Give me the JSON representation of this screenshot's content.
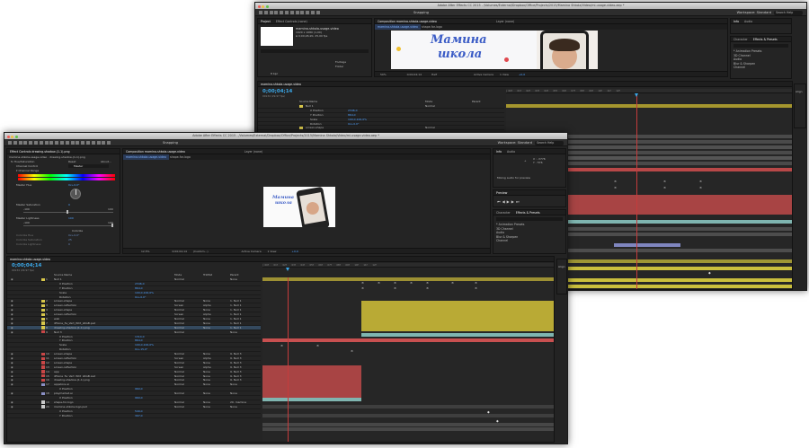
{
  "back": {
    "title": "Adobe After Effects CC 2015 - /Volumes/External/Dropbox/Office/Projects/2015/Mamina Shkola/Video/mi-usage-video.aep *",
    "snapping": "Snapping",
    "workspace_label": "Workspace:",
    "workspace_value": "Standard",
    "search_placeholder": "Search Help",
    "project_tabs": [
      "Project",
      "Effect Controls (none)"
    ],
    "project_info": [
      "mamina-shkola-usage-video",
      "1920 x 1080 (1,00)",
      "Δ 0;00;26;20, 25,00 fps"
    ],
    "project_items": [
      "Footage",
      "Folder"
    ],
    "project_bits": "8 bpc",
    "comp_tab": "Composition mamina-shkola-usage-video",
    "layer_tab": "Layer (none)",
    "comp_subtab": "mamina-shkola-usage-video",
    "comp_subtab2": "shape-for-logo",
    "logo_line1": "Мамина",
    "logo_line2": "школа",
    "viewer_controls": [
      "50%",
      "0;00;04;14",
      "Half",
      "Active Camera",
      "1 View",
      "+0,0"
    ],
    "info_tabs": [
      "Info",
      "Audio"
    ],
    "effects_tabs": [
      "Character",
      "Effects & Presets"
    ],
    "effects_list": [
      "* Animation Presets",
      "3D Channel",
      "Audio",
      "Blur & Sharpen",
      "Channel"
    ],
    "align_label": "Align",
    "timeline_tab": "mamina-shkola-usage-video",
    "timecode": "0;00;04;14",
    "frame_info": "00134 (29.97 fps)",
    "source_header": "Source Name",
    "mode_header": "Mode",
    "parent_header": "Parent",
    "layers": [
      {
        "name": "Null 1",
        "mode": "Normal",
        "color": "#d6c54a"
      },
      {
        "name": "X Position",
        "value": "2346,0",
        "color": ""
      },
      {
        "name": "Y Position",
        "value": "864,0",
        "color": ""
      },
      {
        "name": "Scale",
        "value": "100,0,100,0%",
        "color": ""
      },
      {
        "name": "Rotation",
        "value": "0x+0,0°",
        "color": ""
      },
      {
        "name": "screen-shape",
        "mode": "Normal",
        "color": "#d6c54a"
      }
    ]
  },
  "front": {
    "title": "Adobe After Effects CC 2015 - /Volumes/External/Dropbox/Office/Projects/2015/Mamina Shkola/Video/mi-usage-video.aep *",
    "snapping": "Snapping",
    "workspace_label": "Workspace:",
    "workspace_value": "Standard",
    "search_placeholder": "Search Help",
    "fx_tab": "Effect Controls drawing-shadow-(1-1).png",
    "fx_header": "mamina-shkola-usage-video · drawing-shadow-(1-1).png",
    "fx_rows": [
      {
        "k": "fx Hue/Saturation",
        "v": "Reset",
        "v2": "About..."
      },
      {
        "k": "Channel Control",
        "v": "Master",
        "v2": ""
      },
      {
        "k": "▾ Channel Range",
        "v": "",
        "v2": ""
      },
      {
        "k": "Master Hue",
        "v": "0x+0,0°",
        "v2": ""
      },
      {
        "k": "Master Saturation",
        "v": "0",
        "v2": ""
      },
      {
        "k": "-100",
        "v": "",
        "v2": "100"
      },
      {
        "k": "Master Lightness",
        "v": "100",
        "v2": ""
      },
      {
        "k": "-100",
        "v": "",
        "v2": "100"
      },
      {
        "k": "",
        "v": "Colorize",
        "v2": ""
      },
      {
        "k": "Colorize Hue",
        "v": "0x+0,0°",
        "v2": ""
      },
      {
        "k": "Colorize Saturation",
        "v": "25",
        "v2": ""
      },
      {
        "k": "Colorize Lightness",
        "v": "0",
        "v2": ""
      }
    ],
    "comp_tab": "Composition mamina-shkola-usage-video",
    "layer_tab": "Layer (none)",
    "comp_subtab": "mamina-shkola-usage-video",
    "comp_subtab2": "shape-for-logo",
    "mini_logo1": "Мамина",
    "mini_logo2": "школа",
    "viewer_controls": [
      "12,5%",
      "0;00;04;14",
      "(Custom...)",
      "Active Camera",
      "1 View",
      "+0,0"
    ],
    "info_tabs": [
      "Info",
      "Audio"
    ],
    "info_values": [
      "X : -3776",
      "Y : 576",
      "+"
    ],
    "info_msg": "Mixing audio for preview",
    "preview_label": "Preview",
    "effects_tabs": [
      "Character",
      "Effects & Presets"
    ],
    "effects_list": [
      "* Animation Presets",
      "3D Channel",
      "Audio",
      "Blur & Sharpen",
      "Channel"
    ],
    "align_label": "Align",
    "timeline_tab": "mamina-shkola-usage-video",
    "timecode": "0;00;04;14",
    "frame_info": "00134 (29.97 fps)",
    "source_header": "Source Name",
    "mode_header": "Mode",
    "trkmat_header": "TrkMat",
    "parent_header": "Parent",
    "layers": [
      {
        "num": "1",
        "name": "Null 1",
        "color": "#d6c54a",
        "mode": "Normal",
        "trk": "",
        "parent": "None"
      },
      {
        "num": "",
        "name": "X Position",
        "color": "",
        "value": "2346,0"
      },
      {
        "num": "",
        "name": "Y Position",
        "color": "",
        "value": "864,0"
      },
      {
        "num": "",
        "name": "Scale",
        "color": "",
        "value": "100,0,100,0%"
      },
      {
        "num": "",
        "name": "Rotation",
        "color": "",
        "value": "0x+0,0°"
      },
      {
        "num": "2",
        "name": "screen-shape",
        "color": "#d6c54a",
        "mode": "Normal",
        "trk": "None",
        "parent": "1. Null 1"
      },
      {
        "num": "3",
        "name": "screen-reflection",
        "color": "#d6c54a",
        "mode": "Screen",
        "trk": "Alpha",
        "parent": "1. Null 1"
      },
      {
        "num": "4",
        "name": "screen-shape",
        "color": "#d6c54a",
        "mode": "Normal",
        "trk": "None",
        "parent": "1. Null 1"
      },
      {
        "num": "5",
        "name": "screen-reflection",
        "color": "#d6c54a",
        "mode": "Screen",
        "trk": "Alpha",
        "parent": "1. Null 1"
      },
      {
        "num": "6",
        "name": "web",
        "color": "#d6c54a",
        "mode": "Normal",
        "trk": "None",
        "parent": "1. Null 1"
      },
      {
        "num": "7",
        "name": "iPhone_5s_Vert_Wht_LRGB.psd",
        "color": "#d6c54a",
        "mode": "Normal",
        "trk": "None",
        "parent": "1. Null 1"
      },
      {
        "num": "8",
        "name": "drawing-shadow-(1-1).png",
        "color": "#d6c54a",
        "mode": "Normal",
        "trk": "None",
        "parent": "1. Null 1",
        "sel": true
      },
      {
        "num": "9",
        "name": "Null 3",
        "color": "#c84646",
        "mode": "Normal",
        "trk": "",
        "parent": "None"
      },
      {
        "num": "",
        "name": "X Position",
        "color": "",
        "value": "1314,0"
      },
      {
        "num": "",
        "name": "Y Position",
        "color": "",
        "value": "864,0"
      },
      {
        "num": "",
        "name": "Scale",
        "color": "",
        "value": "100,0,100,0%"
      },
      {
        "num": "",
        "name": "Rotation",
        "color": "",
        "value": "0x+15,0°"
      },
      {
        "num": "10",
        "name": "screen-shape",
        "color": "#c84646",
        "mode": "Normal",
        "trk": "None",
        "parent": "9. Null 3"
      },
      {
        "num": "11",
        "name": "screen-reflection",
        "color": "#c84646",
        "mode": "Screen",
        "trk": "Alpha",
        "parent": "9. Null 3"
      },
      {
        "num": "12",
        "name": "screen-shape",
        "color": "#c84646",
        "mode": "Normal",
        "trk": "None",
        "parent": "9. Null 3"
      },
      {
        "num": "13",
        "name": "screen-reflection",
        "color": "#c84646",
        "mode": "Screen",
        "trk": "Alpha",
        "parent": "9. Null 3"
      },
      {
        "num": "14",
        "name": "app",
        "color": "#c84646",
        "mode": "Normal",
        "trk": "None",
        "parent": "9. Null 3"
      },
      {
        "num": "15",
        "name": "iPhone_5s_Vert_Wht_LRGB.psd",
        "color": "#c84646",
        "mode": "Normal",
        "trk": "None",
        "parent": "9. Null 3"
      },
      {
        "num": "16",
        "name": "drawing-shadow-(1-1).png",
        "color": "#c84646",
        "mode": "Normal",
        "trk": "None",
        "parent": "9. Null 3"
      },
      {
        "num": "17",
        "name": "appstore.ai",
        "color": "#8a8fc4",
        "mode": "Normal",
        "trk": "None",
        "parent": "None"
      },
      {
        "num": "",
        "name": "X Position",
        "color": "",
        "value": "960,0"
      },
      {
        "num": "18",
        "name": "playmarket.ai",
        "color": "#8a8fc4",
        "mode": "Normal",
        "trk": "None",
        "parent": "None"
      },
      {
        "num": "",
        "name": "X Position",
        "color": "",
        "value": "960,0"
      },
      {
        "num": "19",
        "name": "shape-for-logo",
        "color": "#c9c9c9",
        "mode": "Normal",
        "trk": "None",
        "parent": "20. mamina"
      },
      {
        "num": "20",
        "name": "mamina-shkola-logo.psd",
        "color": "#c9c9c9",
        "mode": "Normal",
        "trk": "None",
        "parent": "None"
      },
      {
        "num": "",
        "name": "X Position",
        "color": "",
        "value": "549,0"
      },
      {
        "num": "",
        "name": "Y Position",
        "color": "",
        "value": "397,0"
      }
    ]
  },
  "colors": {
    "accent": "#3aa7e8",
    "playhead": "#c43c3c",
    "yellow": "#b9aa35",
    "red": "#b84848",
    "violet": "#7f86bf",
    "teal": "#7fb5b0"
  }
}
